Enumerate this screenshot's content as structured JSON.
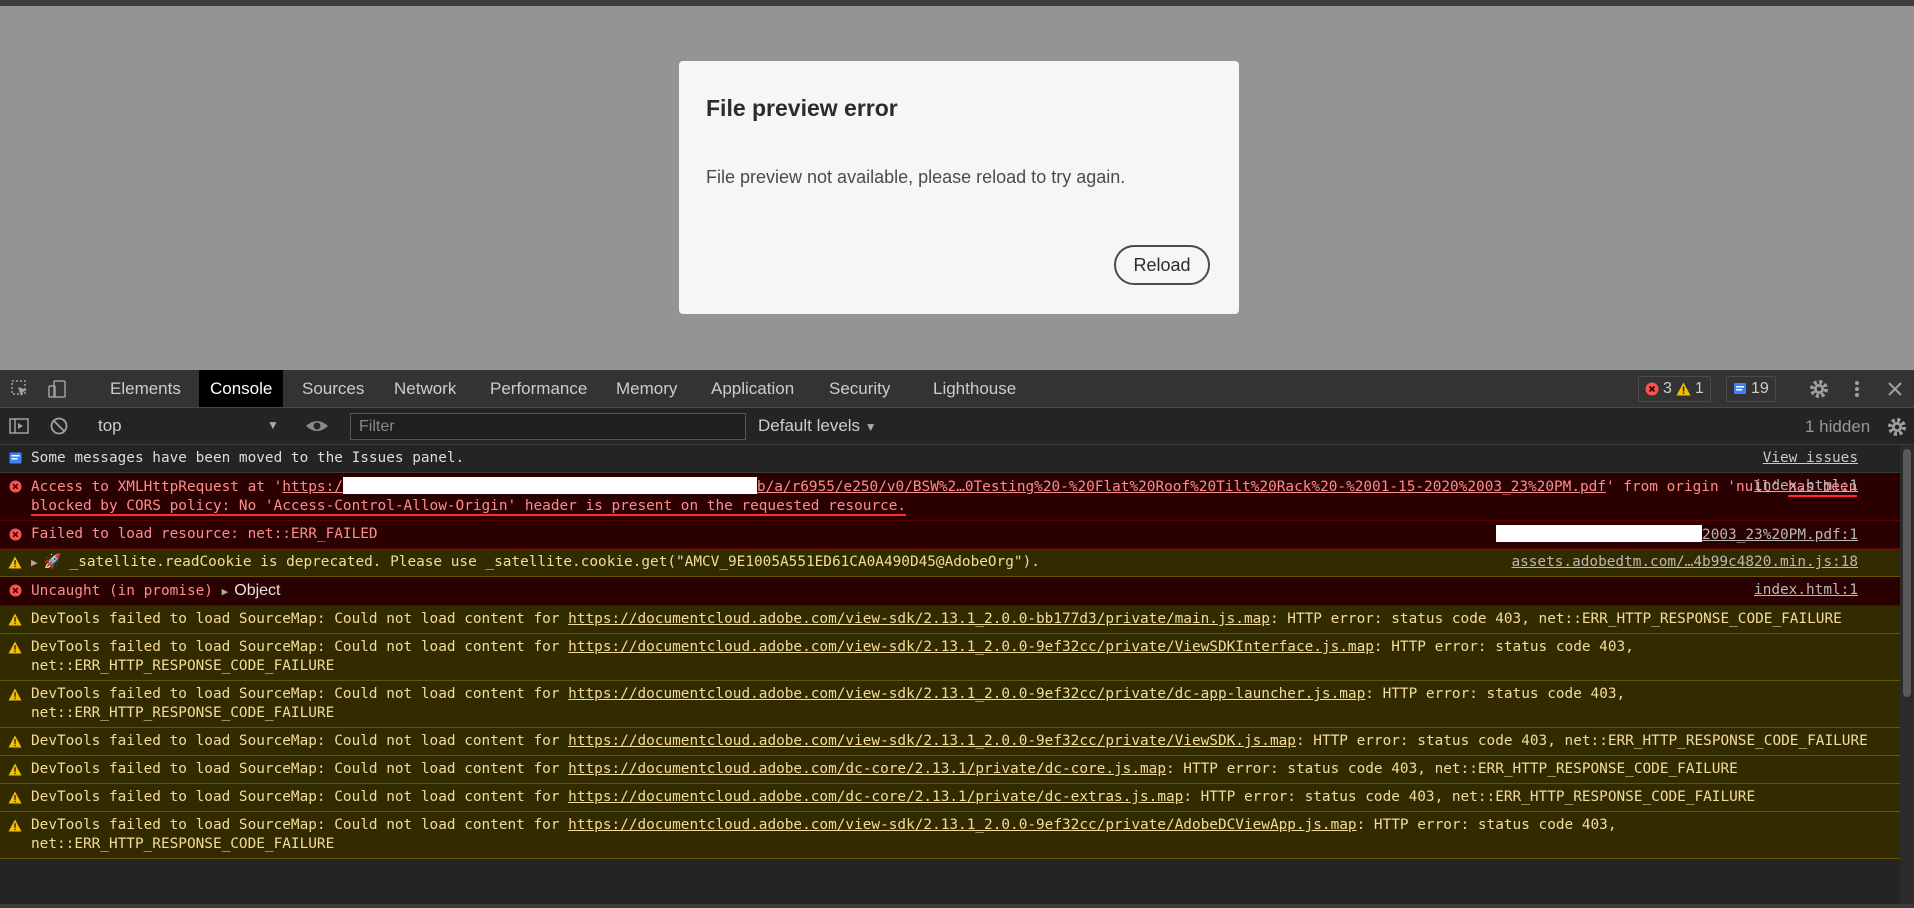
{
  "dialog": {
    "title": "File preview error",
    "message": "File preview not available, please reload to try again.",
    "reload_label": "Reload"
  },
  "devtools": {
    "tabs": [
      "Elements",
      "Console",
      "Sources",
      "Network",
      "Performance",
      "Memory",
      "Application",
      "Security",
      "Lighthouse"
    ],
    "active_tab": "Console",
    "errors_count": "3",
    "warnings_count": "1",
    "messages_count": "19",
    "context": "top",
    "filter_placeholder": "Filter",
    "levels_label": "Default levels",
    "hidden_label": "1 hidden",
    "colors": {
      "error": "#ff5050",
      "warning": "#f2c000",
      "info": "#3e82f7",
      "active_tab_bg": "#000000"
    }
  },
  "console": {
    "issues_message": "Some messages have been moved to the Issues panel.",
    "view_issues": "View issues",
    "cors": {
      "pre": "Access to XMLHttpRequest at '",
      "link_start": "https:/",
      "link_end": "b/a/r6955/e250/v0/BSW%2…0Testing%20-%20Flat%20Roof%20Tilt%20Rack%20-%2001-15-2020%2003_23%20PM.pdf",
      "mid": "' from origin 'null'",
      "highlighted": "has been blocked by CORS policy: No 'Access-Control-Allow-Origin' header is present on the requested resource.",
      "source": "index.html:1"
    },
    "failed_load": {
      "text": "Failed to load resource: net::ERR_FAILED",
      "source": "2003_23%20PM.pdf:1"
    },
    "satellite": {
      "text": "_satellite.readCookie is deprecated. Please use _satellite.cookie.get(\"AMCV_9E1005A551ED61CA0A490D45@AdobeOrg\").",
      "source": "assets.adobedtm.com/…4b99c4820.min.js:18"
    },
    "uncaught": {
      "text": "Uncaught (in promise)",
      "object": "Object",
      "source": "index.html:1"
    },
    "sourcemap_prefix": "DevTools failed to load SourceMap: Could not load content for",
    "sourcemaps": [
      {
        "url": "https://documentcloud.adobe.com/view-sdk/2.13.1_2.0.0-bb177d3/private/main.js.map",
        "suffix": ": HTTP error: status code 403, net::ERR_HTTP_RESPONSE_CODE_FAILURE"
      },
      {
        "url": "https://documentcloud.adobe.com/view-sdk/2.13.1_2.0.0-9ef32cc/private/ViewSDKInterface.js.map",
        "suffix": ": HTTP error: status code 403, net::ERR_HTTP_RESPONSE_CODE_FAILURE"
      },
      {
        "url": "https://documentcloud.adobe.com/view-sdk/2.13.1_2.0.0-9ef32cc/private/dc-app-launcher.js.map",
        "suffix": ": HTTP error: status code 403, net::ERR_HTTP_RESPONSE_CODE_FAILURE"
      },
      {
        "url": "https://documentcloud.adobe.com/view-sdk/2.13.1_2.0.0-9ef32cc/private/ViewSDK.js.map",
        "suffix": ": HTTP error: status code 403, net::ERR_HTTP_RESPONSE_CODE_FAILURE"
      },
      {
        "url": "https://documentcloud.adobe.com/dc-core/2.13.1/private/dc-core.js.map",
        "suffix": ": HTTP error: status code 403, net::ERR_HTTP_RESPONSE_CODE_FAILURE"
      },
      {
        "url": "https://documentcloud.adobe.com/dc-core/2.13.1/private/dc-extras.js.map",
        "suffix": ": HTTP error: status code 403, net::ERR_HTTP_RESPONSE_CODE_FAILURE"
      },
      {
        "url": "https://documentcloud.adobe.com/view-sdk/2.13.1_2.0.0-9ef32cc/private/AdobeDCViewApp.js.map",
        "suffix": ": HTTP error: status code 403, net::ERR_HTTP_RESPONSE_CODE_FAILURE"
      }
    ]
  }
}
